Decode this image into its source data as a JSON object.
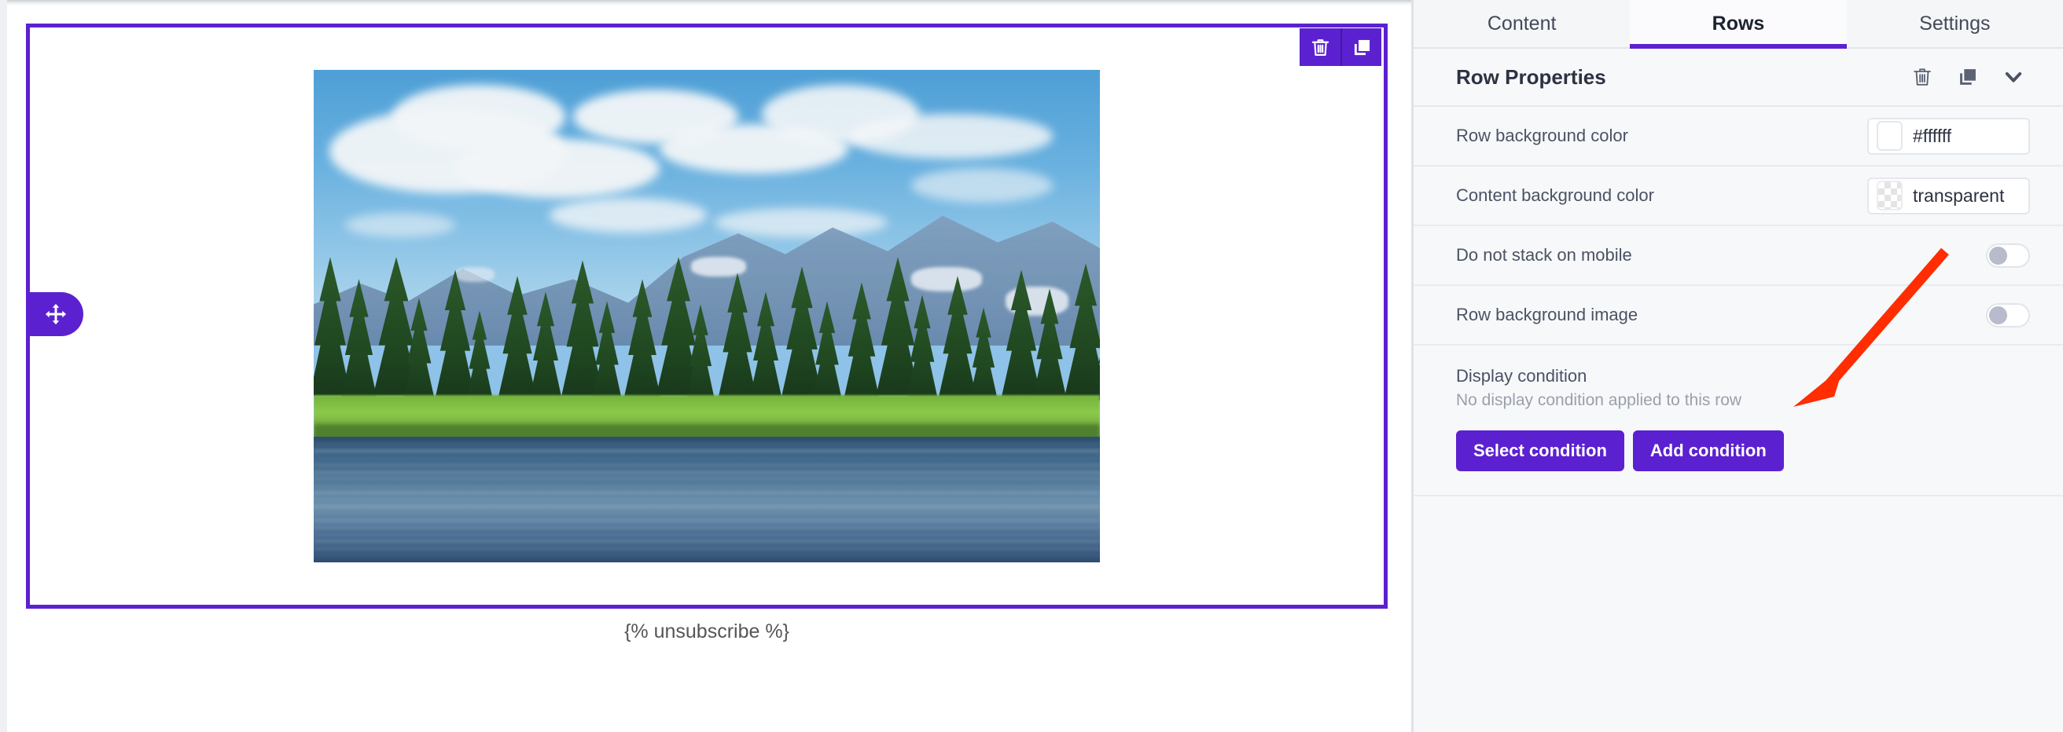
{
  "canvas": {
    "row_toolbar": {
      "delete_icon": "trash-icon",
      "duplicate_icon": "duplicate-icon"
    },
    "drag_handle_icon": "move-arrows-icon",
    "image_alt": "mountain lake with pine forest and clouds",
    "footer_text": "{% unsubscribe %}",
    "selected_row_border_color": "#5b21d0"
  },
  "panel": {
    "tabs": [
      {
        "label": "Content",
        "active": false
      },
      {
        "label": "Rows",
        "active": true
      },
      {
        "label": "Settings",
        "active": false
      }
    ],
    "header": {
      "title": "Row Properties",
      "icons": [
        "trash-icon",
        "duplicate-icon",
        "chevron-down-icon"
      ]
    },
    "properties": [
      {
        "label": "Row background color",
        "type": "color",
        "value": "#ffffff",
        "swatch": "#ffffff"
      },
      {
        "label": "Content background color",
        "type": "color",
        "value": "transparent",
        "swatch": "transparent"
      },
      {
        "label": "Do not stack on mobile",
        "type": "toggle",
        "value": "off"
      },
      {
        "label": "Row background image",
        "type": "toggle",
        "value": "off"
      }
    ],
    "display_condition": {
      "title": "Display condition",
      "subtitle": "No display condition applied to this row",
      "select_button": "Select condition",
      "add_button": "Add condition"
    }
  },
  "annotation": {
    "arrow_color": "#ff2d00",
    "points_to": "Add condition"
  },
  "colors": {
    "accent": "#5b21d0",
    "panel_bg": "#f7f8fa",
    "text": "#2c3242",
    "muted": "#9aa0ab"
  }
}
